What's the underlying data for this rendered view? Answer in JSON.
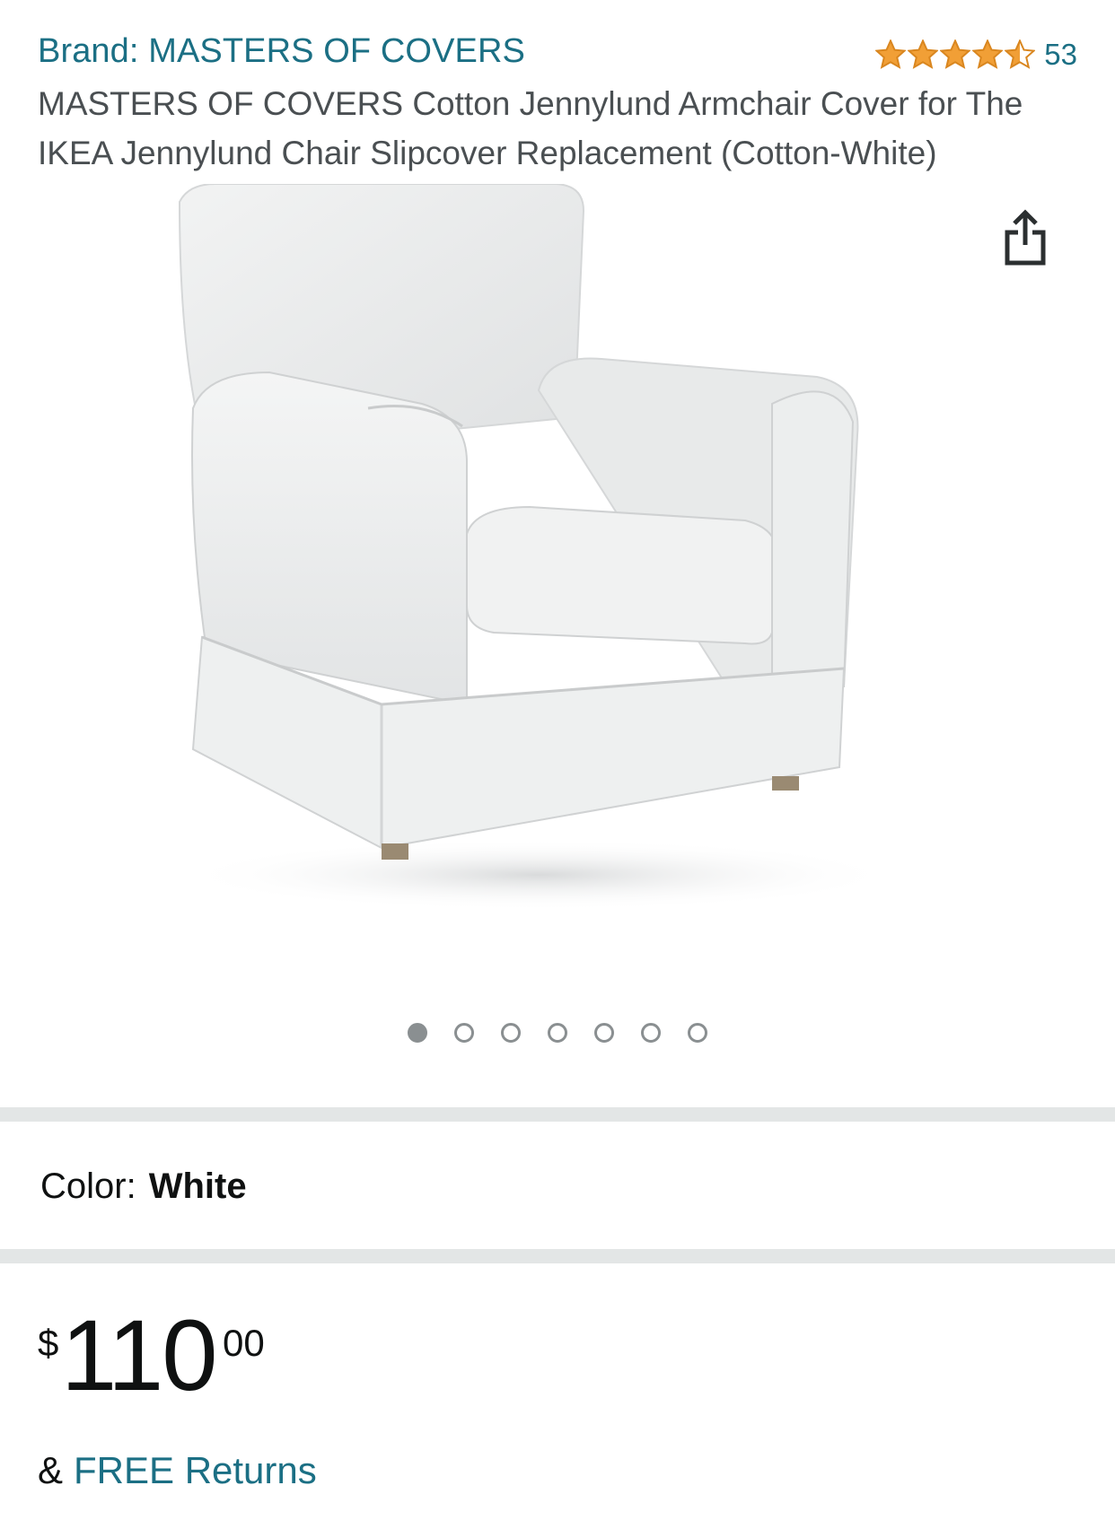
{
  "header": {
    "brand_link": "Brand: MASTERS OF COVERS",
    "rating": 4.5,
    "rating_count": "53",
    "title": "MASTERS OF COVERS Cotton Jennylund Armchair Cover for The IKEA Jennylund Chair Slipcover Replacement (Cotton-White)"
  },
  "gallery": {
    "image_subject": "white slipcovered armchair",
    "dots_total": 7,
    "dots_active_index": 0,
    "share_icon": "share-icon"
  },
  "color": {
    "label": "Color:",
    "value": "White"
  },
  "price": {
    "symbol": "$",
    "whole": "110",
    "fraction": "00"
  },
  "returns": {
    "prefix": "&",
    "link": "FREE Returns"
  },
  "colors": {
    "link": "#1b6f84",
    "star": "#f19f36",
    "divider": "#e3e6e6",
    "dot": "#8a8f91"
  }
}
